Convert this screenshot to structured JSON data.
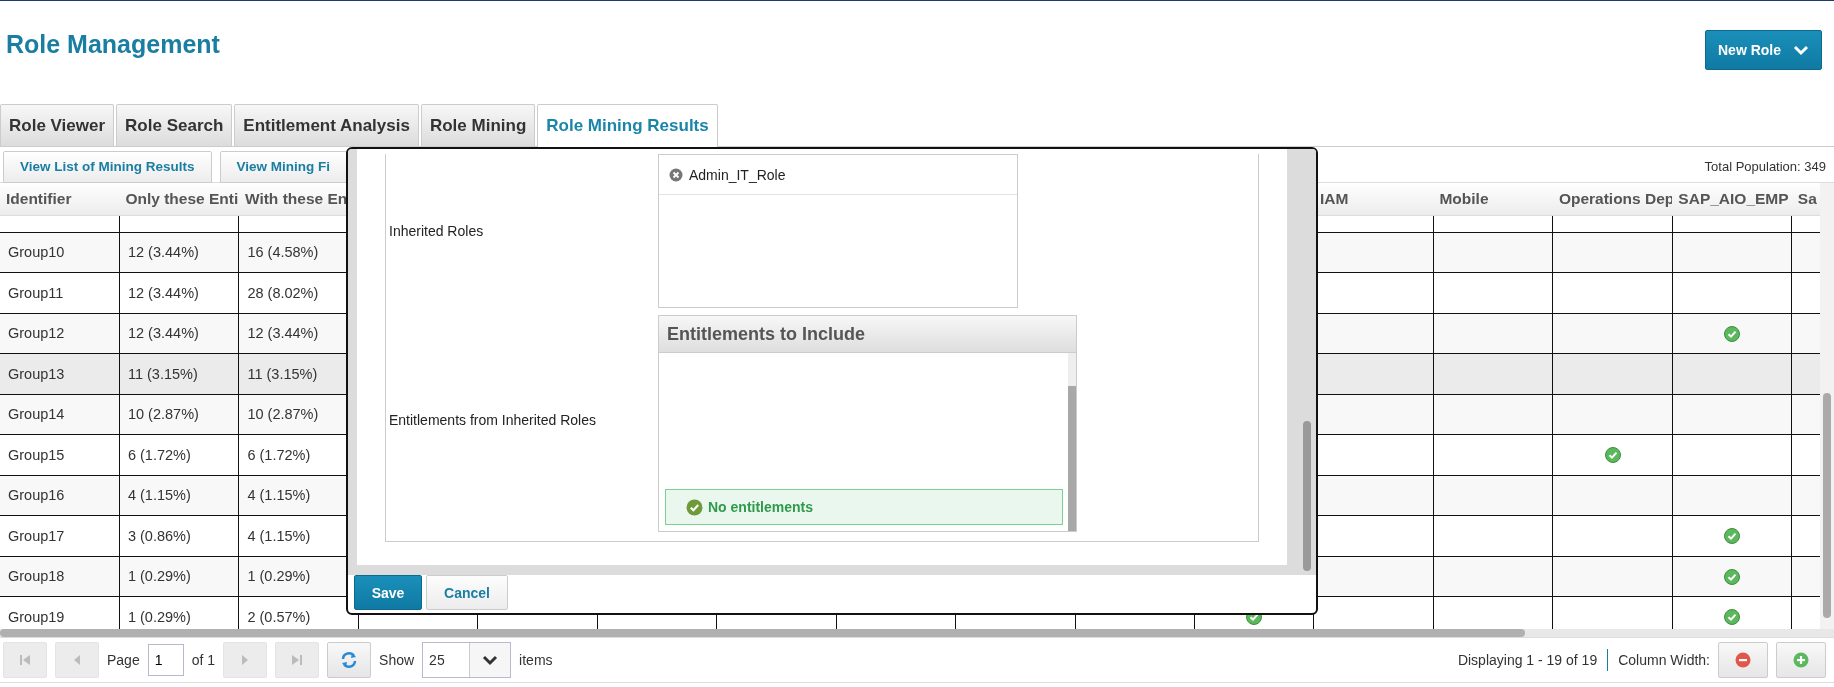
{
  "page": {
    "title": "Role Management"
  },
  "new_role_button": {
    "label": "New Role"
  },
  "tabs": [
    {
      "label": "Role Viewer",
      "selected": false
    },
    {
      "label": "Role Search",
      "selected": false
    },
    {
      "label": "Entitlement Analysis",
      "selected": false
    },
    {
      "label": "Role Mining",
      "selected": false
    },
    {
      "label": "Role Mining Results",
      "selected": true
    }
  ],
  "subtabs": [
    {
      "label": "View List of Mining Results"
    },
    {
      "label": "View Mining Fi"
    }
  ],
  "total_population": "Total Population: 349",
  "table": {
    "columns": [
      "Identifier",
      "Only these Enti",
      "With these En"
    ],
    "check_column_labels": [
      "IAM",
      "Mobile",
      "Operations Dep",
      "SAP_AIO_EMP",
      "Sa"
    ],
    "rows": [
      {
        "identifier": "Group10",
        "only": "12 (3.44%)",
        "with": "16 (4.58%)",
        "selected": false,
        "checks": [
          false,
          false,
          false,
          false
        ]
      },
      {
        "identifier": "Group11",
        "only": "12 (3.44%)",
        "with": "28 (8.02%)",
        "selected": false,
        "checks": [
          false,
          false,
          false,
          false
        ]
      },
      {
        "identifier": "Group12",
        "only": "12 (3.44%)",
        "with": "12 (3.44%)",
        "selected": false,
        "checks": [
          false,
          false,
          false,
          true
        ]
      },
      {
        "identifier": "Group13",
        "only": "11 (3.15%)",
        "with": "11 (3.15%)",
        "selected": true,
        "checks": [
          false,
          false,
          false,
          false
        ]
      },
      {
        "identifier": "Group14",
        "only": "10 (2.87%)",
        "with": "10 (2.87%)",
        "selected": false,
        "checks": [
          false,
          false,
          false,
          false
        ]
      },
      {
        "identifier": "Group15",
        "only": "6 (1.72%)",
        "with": "6 (1.72%)",
        "selected": false,
        "checks": [
          false,
          false,
          true,
          false
        ]
      },
      {
        "identifier": "Group16",
        "only": "4 (1.15%)",
        "with": "4 (1.15%)",
        "selected": false,
        "checks": [
          false,
          false,
          false,
          false
        ]
      },
      {
        "identifier": "Group17",
        "only": "3 (0.86%)",
        "with": "4 (1.15%)",
        "selected": false,
        "checks": [
          false,
          false,
          false,
          true
        ]
      },
      {
        "identifier": "Group18",
        "only": "1 (0.29%)",
        "with": "1 (0.29%)",
        "selected": false,
        "checks": [
          false,
          false,
          false,
          true
        ]
      },
      {
        "identifier": "Group19",
        "only": "1 (0.29%)",
        "with": "2 (0.57%)",
        "selected": false,
        "checks": [
          false,
          false,
          false,
          true
        ],
        "covered_column_check": true
      }
    ]
  },
  "dialog": {
    "fields": [
      {
        "label": "Inherited Roles",
        "kind": "role_list",
        "items": [
          "Admin_IT_Role"
        ]
      },
      {
        "label": "Entitlements from Inherited Roles",
        "kind": "entitlement_panel",
        "title": "Entitlements to Include",
        "message": "No entitlements"
      }
    ],
    "buttons": [
      {
        "label": "Save",
        "primary": true
      },
      {
        "label": "Cancel",
        "primary": false
      }
    ]
  },
  "pager": {
    "nav_buttons": [
      {
        "kind": "first",
        "disabled": true
      },
      {
        "kind": "prev",
        "disabled": true
      },
      {
        "kind": "next",
        "disabled": true
      },
      {
        "kind": "last",
        "disabled": true
      }
    ],
    "page_label": "Page",
    "page_value": "1",
    "of_label": "of 1",
    "show_label": "Show",
    "page_size": "25",
    "items_label": "items",
    "displaying": "Displaying 1 - 19 of 19",
    "column_width_label": "Column Width:"
  }
}
